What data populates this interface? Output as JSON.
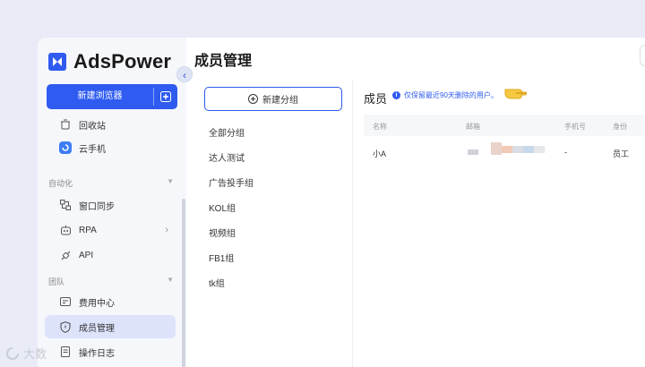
{
  "brand": {
    "name": "AdsPower"
  },
  "sidebar": {
    "new_browser_label": "新建浏览器",
    "items": [
      {
        "label": "回收站",
        "icon": "trash-icon"
      },
      {
        "label": "云手机",
        "icon": "cloud-phone-icon"
      },
      {
        "label": "窗口同步",
        "icon": "window-sync-icon"
      },
      {
        "label": "RPA",
        "icon": "robot-icon"
      },
      {
        "label": "API",
        "icon": "api-plug-icon"
      },
      {
        "label": "费用中心",
        "icon": "billing-icon"
      },
      {
        "label": "成员管理",
        "icon": "shield-icon"
      },
      {
        "label": "操作日志",
        "icon": "log-icon"
      }
    ],
    "sections": [
      {
        "label": "自动化"
      },
      {
        "label": "团队"
      }
    ],
    "active_item": "成员管理"
  },
  "page": {
    "title": "成员管理"
  },
  "groups": {
    "new_group_label": "新建分组",
    "items": [
      "全部分组",
      "达人测试",
      "广告投手组",
      "KOL组",
      "视频组",
      "FB1组",
      "tk组"
    ]
  },
  "members": {
    "title": "成员",
    "tip": "仅保留最近90天删除的用户。",
    "columns": [
      "名称",
      "邮箱",
      "手机号",
      "身份"
    ],
    "rows": [
      {
        "name": "小A",
        "phone": "-",
        "role": "员工"
      }
    ]
  },
  "colors": {
    "accent": "#2f5bf0",
    "active_bg": "#dde3fb"
  }
}
